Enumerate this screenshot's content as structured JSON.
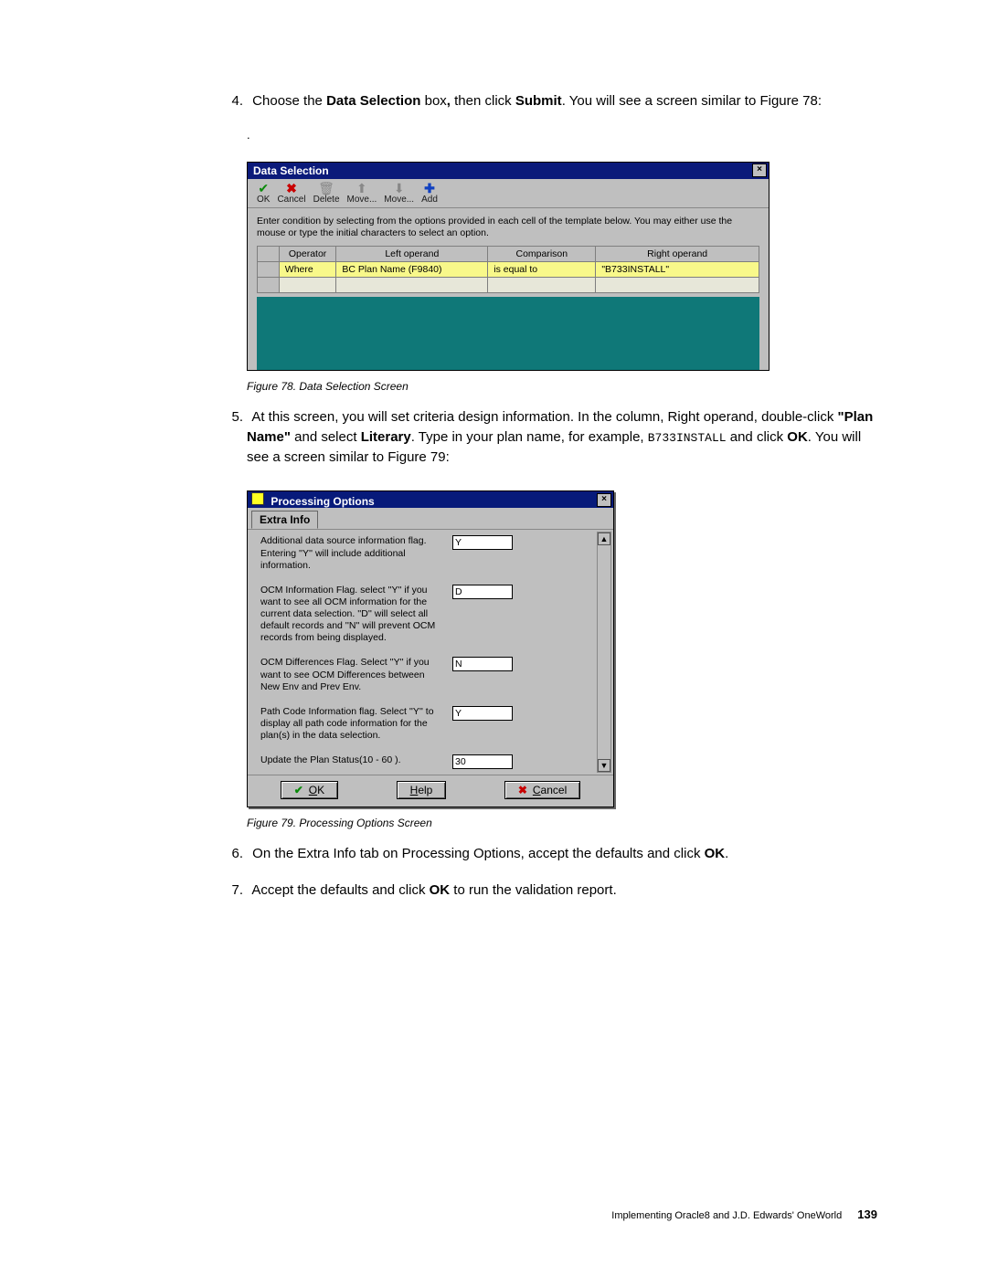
{
  "step4": {
    "num": "4.",
    "pre": "Choose the ",
    "b1": "Data Selection",
    "mid1": " box",
    "comma": ",",
    "mid2": " then click ",
    "b2": "Submit",
    "post": ". You will see a screen similar to Figure 78:"
  },
  "dot": ".",
  "ds": {
    "title": "Data Selection",
    "close": "×",
    "toolbar": {
      "ok": {
        "icon": "✔",
        "label": "OK"
      },
      "cancel": {
        "icon": "✖",
        "label": "Cancel"
      },
      "delete": {
        "icon": "🗑",
        "label": "Delete"
      },
      "moveUp": {
        "icon": "⬆",
        "label": "Move..."
      },
      "moveDn": {
        "icon": "⬇",
        "label": "Move..."
      },
      "add": {
        "icon": "✚",
        "label": "Add"
      }
    },
    "instr": "Enter condition by selecting from the options provided in each cell of the template below. You may either use the mouse or type the initial characters to select an option.",
    "headers": {
      "op": "Operator",
      "left": "Left operand",
      "cmp": "Comparison",
      "right": "Right operand"
    },
    "row": {
      "op": "Where",
      "left": "BC Plan Name (F9840)",
      "cmp": "is equal to",
      "right": "\"B733INSTALL\""
    }
  },
  "figcap78": "Figure 78.  Data Selection Screen",
  "step5": {
    "num": "5.",
    "l1a": "At this screen, you will set criteria design information. In the column, Right operand, double-click ",
    "b1": "\"Plan Name\"",
    "l1b": " and select ",
    "b2": "Literary",
    "l1c": ". Type in your plan name, for example,  ",
    "code": "B733INSTALL",
    "l1d": " and click ",
    "b3": "OK",
    "l1e": ". You will see a screen similar to Figure 79:"
  },
  "po": {
    "title": "Processing Options",
    "close": "×",
    "tab": "Extra Info",
    "rows": [
      {
        "desc": "Additional data source information flag. Entering ''Y'' will include additional information.",
        "val": "Y"
      },
      {
        "desc": "OCM Information Flag.  select ''Y'' if you want to see all OCM information for the current data selection. ''D'' will select all default records and ''N'' will prevent OCM records from being displayed.",
        "val": "D"
      },
      {
        "desc": "OCM Differences Flag. Select ''Y'' if you want to see OCM Differences between New Env and Prev Env.",
        "val": "N"
      },
      {
        "desc": "Path Code Information flag.  Select ''Y'' to display all path code information for the plan(s) in the data selection.",
        "val": "Y"
      },
      {
        "desc": "Update the Plan Status(10 - 60 ).",
        "val": "30"
      }
    ],
    "btns": {
      "ok": "OK",
      "help": "Help",
      "cancel": "Cancel"
    }
  },
  "figcap79": "Figure 79.  Processing Options Screen",
  "step6": {
    "num": "6.",
    "a": "On the Extra Info tab on Processing Options, accept the defaults and click ",
    "b": "OK",
    "c": "."
  },
  "step7": {
    "num": "7.",
    "a": "Accept the defaults and click ",
    "b": "OK",
    "c": " to run the validation report."
  },
  "footer": {
    "text": "Implementing Oracle8 and J.D. Edwards' OneWorld",
    "page": "139"
  }
}
